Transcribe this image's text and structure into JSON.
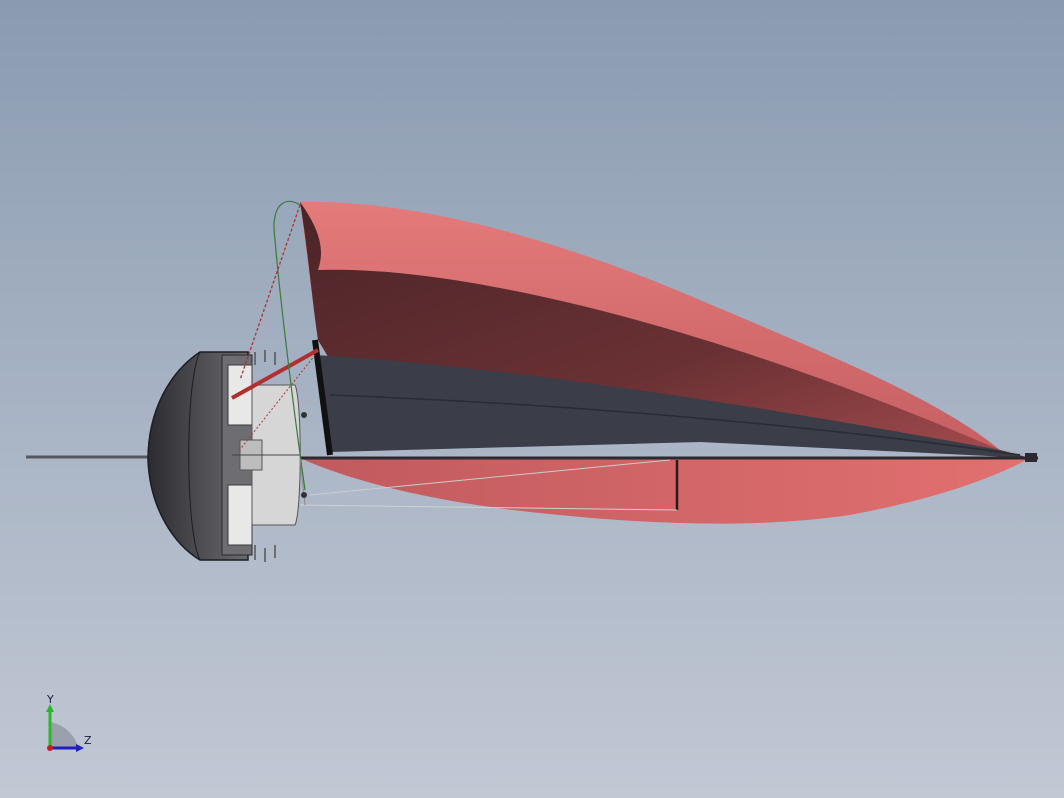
{
  "viewport": {
    "background_top": "#8a9bb0",
    "background_bottom": "#c2c8d4"
  },
  "model": {
    "colors": {
      "sail": "#e37373",
      "sail_shadow": "#5a2a2e",
      "hull": "#4a4a4e",
      "deck": "#dcdcdc",
      "rigging_red": "#b03030",
      "rigging_green": "#3a7a3a",
      "spar": "#2a2a30"
    }
  },
  "triad": {
    "y_label": "Y",
    "z_label": "Z",
    "y_color": "#2db52d",
    "z_color": "#2020c0",
    "origin_color": "#c02020",
    "icon": "coordinate-triad-icon"
  }
}
